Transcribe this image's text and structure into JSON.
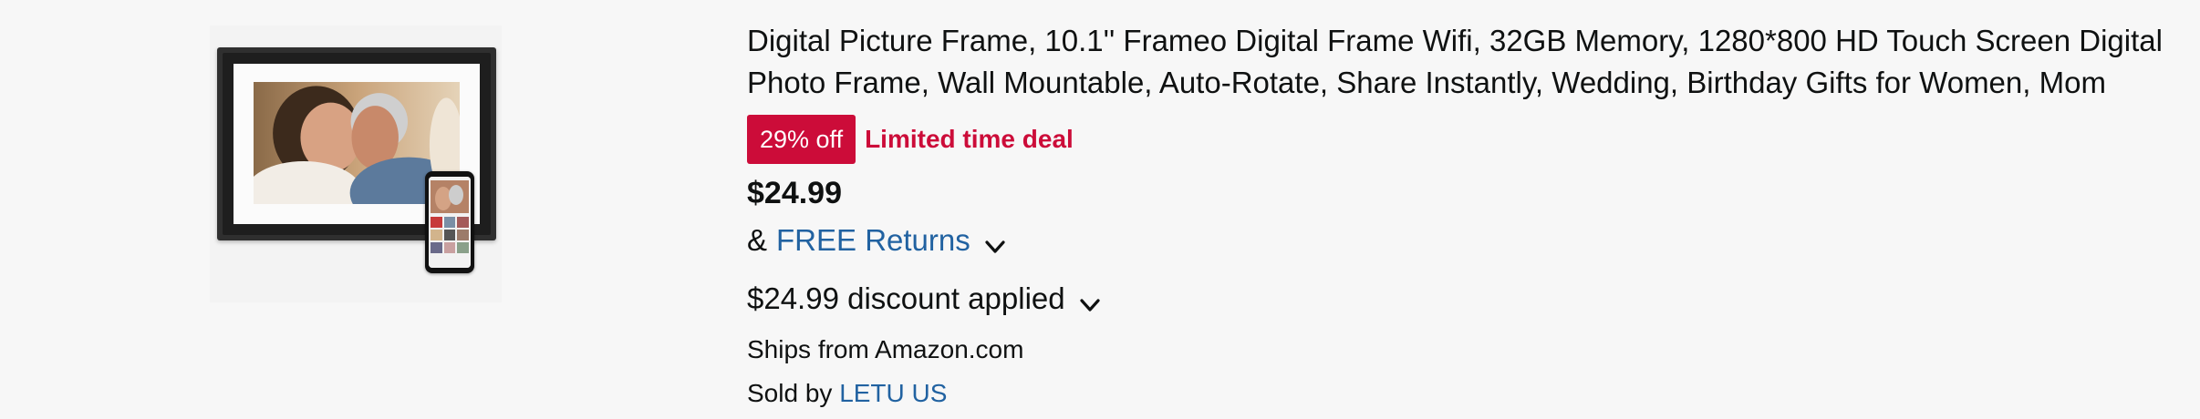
{
  "product": {
    "title": "Digital Picture Frame, 10.1'' Frameo Digital Frame Wifi, 32GB Memory, 1280*800 HD Touch Screen Digital Photo Frame, Wall Mountable, Auto-Rotate, Share Instantly, Wedding, Birthday Gifts for Women, Mom",
    "image_icon": "digital-photo-frame-image"
  },
  "deal": {
    "badge": "29% off",
    "label": "Limited time deal"
  },
  "price": "$24.99",
  "returns": {
    "prefix": "&",
    "link": "FREE Returns",
    "icon": "chevron-down-icon"
  },
  "discount": {
    "text": "$24.99 discount applied",
    "icon": "chevron-down-icon"
  },
  "ships": "Ships from Amazon.com",
  "sold": {
    "prefix": "Sold by",
    "seller": "LETU US"
  },
  "colors": {
    "deal_red": "#cc0c39",
    "link_blue": "#2162a1",
    "text": "#0f1111",
    "background": "#f7f7f7"
  }
}
